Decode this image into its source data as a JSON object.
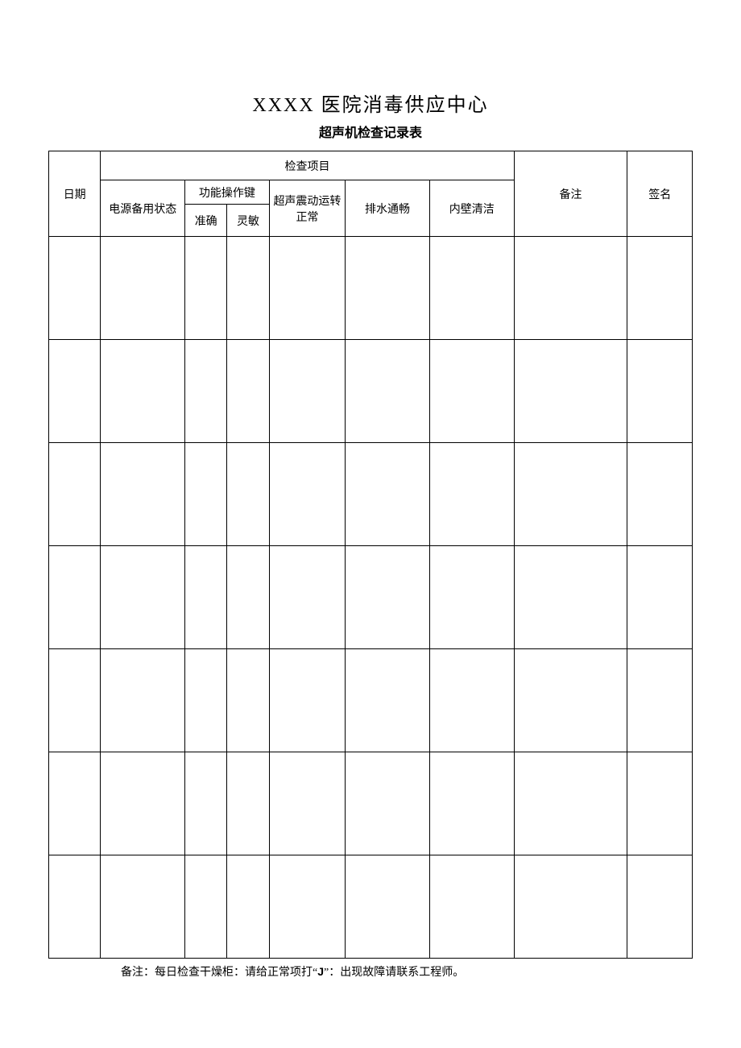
{
  "header": {
    "title_main": "XXXX 医院消毒供应中心",
    "title_sub": "超声机检查记录表"
  },
  "table": {
    "headers": {
      "date": "日期",
      "inspection_items": "检查项目",
      "power_status": "电源备用状态",
      "function_keys": "功能操作键",
      "accurate": "准确",
      "sensitive": "灵敏",
      "ultrasonic_normal": "超声震动运转正常",
      "drain_smooth": "排水通畅",
      "inner_clean": "内壁清洁",
      "remark": "备注",
      "signature": "签名"
    },
    "rows": [
      {
        "date": "",
        "power": "",
        "accurate": "",
        "sensitive": "",
        "ultra": "",
        "drain": "",
        "clean": "",
        "remark": "",
        "sign": ""
      },
      {
        "date": "",
        "power": "",
        "accurate": "",
        "sensitive": "",
        "ultra": "",
        "drain": "",
        "clean": "",
        "remark": "",
        "sign": ""
      },
      {
        "date": "",
        "power": "",
        "accurate": "",
        "sensitive": "",
        "ultra": "",
        "drain": "",
        "clean": "",
        "remark": "",
        "sign": ""
      },
      {
        "date": "",
        "power": "",
        "accurate": "",
        "sensitive": "",
        "ultra": "",
        "drain": "",
        "clean": "",
        "remark": "",
        "sign": ""
      },
      {
        "date": "",
        "power": "",
        "accurate": "",
        "sensitive": "",
        "ultra": "",
        "drain": "",
        "clean": "",
        "remark": "",
        "sign": ""
      },
      {
        "date": "",
        "power": "",
        "accurate": "",
        "sensitive": "",
        "ultra": "",
        "drain": "",
        "clean": "",
        "remark": "",
        "sign": ""
      },
      {
        "date": "",
        "power": "",
        "accurate": "",
        "sensitive": "",
        "ultra": "",
        "drain": "",
        "clean": "",
        "remark": "",
        "sign": ""
      }
    ]
  },
  "footnote": {
    "prefix": "备注：每日检查干燥柜：请给正常项打“",
    "mark": "J",
    "suffix": "”：出现故障请联系工程师。"
  }
}
